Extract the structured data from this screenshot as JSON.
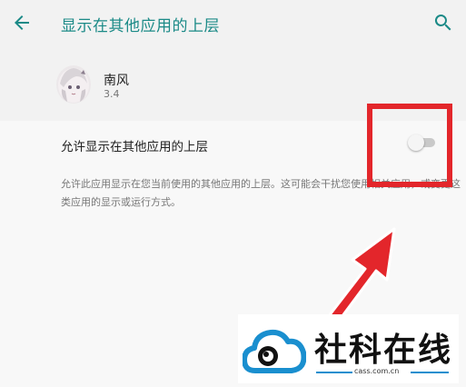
{
  "header": {
    "back_icon": "arrow-left-icon",
    "title": "显示在其他应用的上层",
    "search_icon": "search-icon"
  },
  "app": {
    "name": "南风",
    "version": "3.4"
  },
  "permission": {
    "label": "允许显示在其他应用的上层",
    "enabled": false,
    "description": "允许此应用显示在您当前使用的其他应用的上层。这可能会干扰您使用相关应用，或变更这类应用的显示或运行方式。"
  },
  "watermark": {
    "text": "社科在线",
    "url": "cass.com.cn"
  },
  "colors": {
    "accent": "#1b8a87",
    "highlight": "#e3262b",
    "watermark_blue": "#1a8fcf"
  }
}
